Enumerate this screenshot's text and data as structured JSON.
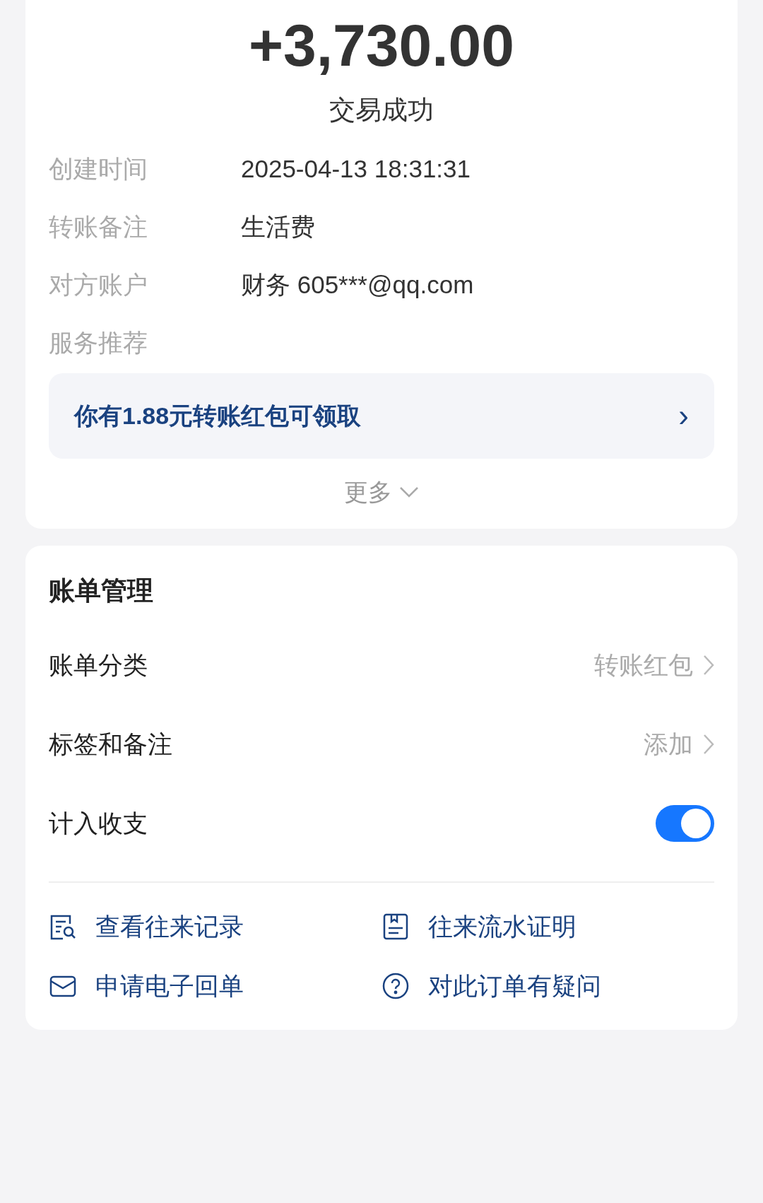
{
  "amount": "+3,730.00",
  "status": "交易成功",
  "details": [
    {
      "label": "创建时间",
      "value": "2025-04-13 18:31:31"
    },
    {
      "label": "转账备注",
      "value": "生活费"
    },
    {
      "label": "对方账户",
      "value": "财务 605***@qq.com"
    },
    {
      "label": "服务推荐"
    }
  ],
  "promo": {
    "text": "你有1.88元转账红包可领取",
    "arrow": "›"
  },
  "more": "更多",
  "bill": {
    "title": "账单管理",
    "rows": [
      {
        "kind": "link",
        "label": "账单分类",
        "value": "转账红包"
      },
      {
        "kind": "link",
        "label": "标签和备注",
        "value": "添加"
      },
      {
        "kind": "toggle",
        "label": "计入收支",
        "on": true
      }
    ],
    "actions": [
      {
        "kind": "records",
        "label": "查看往来记录"
      },
      {
        "kind": "statement",
        "label": "往来流水证明"
      },
      {
        "kind": "mail",
        "label": "申请电子回单"
      },
      {
        "kind": "question",
        "label": "对此订单有疑问"
      }
    ]
  }
}
